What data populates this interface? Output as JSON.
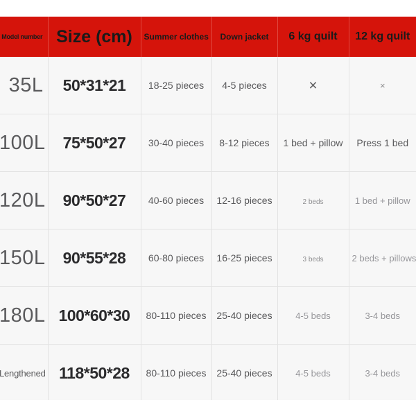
{
  "table": {
    "headers": [
      {
        "key": "model",
        "label": "Model number"
      },
      {
        "key": "size",
        "label": "Size (cm)"
      },
      {
        "key": "summer",
        "label": "Summer clothes"
      },
      {
        "key": "down",
        "label": "Down jacket"
      },
      {
        "key": "q6",
        "label": "6 kg quilt"
      },
      {
        "key": "q12",
        "label": "12 kg quilt"
      }
    ],
    "header_bg": "#d5140b",
    "header_text_color": "#1a1a1a",
    "body_bg": "#f7f7f7",
    "grid_color": "#e3e3e3",
    "rows": [
      {
        "model": "35L",
        "size": "50*31*21",
        "summer": "18-25 pieces",
        "down": "4-5 pieces",
        "q6": "×",
        "q12": "×"
      },
      {
        "model": "100L",
        "size": "75*50*27",
        "summer": "30-40 pieces",
        "down": "8-12 pieces",
        "q6": "1 bed + pillow",
        "q12": "Press 1 bed"
      },
      {
        "model": "120L",
        "size": "90*50*27",
        "summer": "40-60 pieces",
        "down": "12-16 pieces",
        "q6": "2 beds",
        "q12": "1 bed + pillow"
      },
      {
        "model": "150L",
        "size": "90*55*28",
        "summer": "60-80 pieces",
        "down": "16-25 pieces",
        "q6": "3 beds",
        "q12": "2 beds + pillows"
      },
      {
        "model": "180L",
        "size": "100*60*30",
        "summer": "80-110 pieces",
        "down": "25-40 pieces",
        "q6": "4-5 beds",
        "q12": "3-4 beds"
      },
      {
        "model": "Lengthened",
        "size": "118*50*28",
        "summer": "80-110 pieces",
        "down": "25-40 pieces",
        "q6": "4-5 beds",
        "q12": "3-4 beds"
      }
    ]
  }
}
